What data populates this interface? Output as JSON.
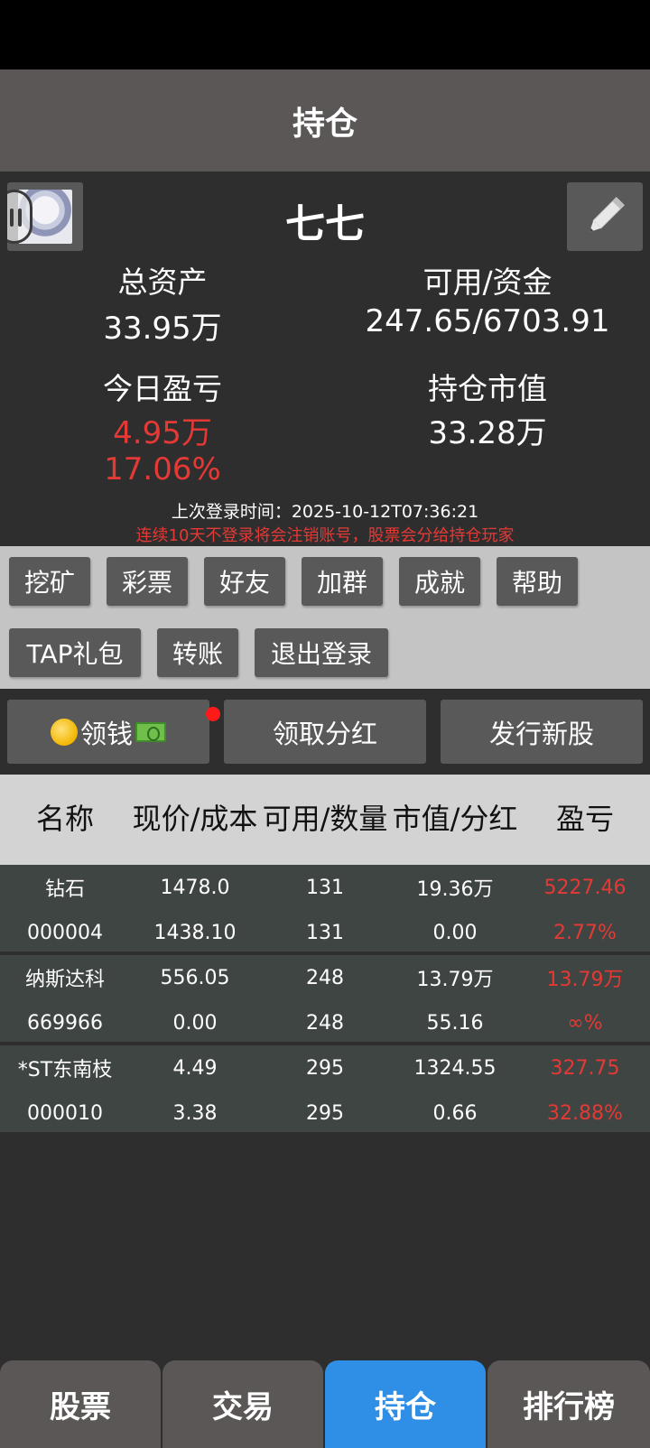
{
  "header": {
    "title": "持仓"
  },
  "profile": {
    "nickname": "七七",
    "total_assets_label": "总资产",
    "total_assets_value": "33.95万",
    "available_funds_label": "可用/资金",
    "available_funds_value": "247.65/6703.91",
    "today_pnl_label": "今日盈亏",
    "today_pnl_value": "4.95万",
    "today_pnl_percent": "17.06%",
    "market_value_label": "持仓市值",
    "market_value_value": "33.28万",
    "last_login": "上次登录时间：2025-10-12T07:36:21",
    "warning": "连续10天不登录将会注销账号，股票会分给持仓玩家"
  },
  "menu": {
    "mining": "挖矿",
    "lottery": "彩票",
    "friends": "好友",
    "join_group": "加群",
    "achievements": "成就",
    "help": "帮助",
    "tap_gift": "TAP礼包",
    "transfer": "转账",
    "logout": "退出登录"
  },
  "actions": {
    "collect_money": "领钱",
    "collect_dividend": "领取分红",
    "issue_stock": "发行新股"
  },
  "table": {
    "headers": [
      "名称",
      "现价/成本",
      "可用/数量",
      "市值/分红",
      "盈亏"
    ],
    "rows": [
      {
        "name": "钻石",
        "code": "000004",
        "price": "1478.0",
        "cost": "1438.10",
        "available": "131",
        "quantity": "131",
        "market_value": "19.36万",
        "dividend": "0.00",
        "pnl": "5227.46",
        "pnl_percent": "2.77%"
      },
      {
        "name": "纳斯达科",
        "code": "669966",
        "price": "556.05",
        "cost": "0.00",
        "available": "248",
        "quantity": "248",
        "market_value": "13.79万",
        "dividend": "55.16",
        "pnl": "13.79万",
        "pnl_percent": "∞%"
      },
      {
        "name": "*ST东南枝",
        "code": "000010",
        "price": "4.49",
        "cost": "3.38",
        "available": "295",
        "quantity": "295",
        "market_value": "1324.55",
        "dividend": "0.66",
        "pnl": "327.75",
        "pnl_percent": "32.88%"
      }
    ]
  },
  "bottom_nav": {
    "stocks": "股票",
    "trade": "交易",
    "holdings": "持仓",
    "ranking": "排行榜"
  },
  "colors": {
    "accent": "#2f8ee6",
    "loss_profit_red": "#e53935",
    "header_bg": "#5a5756",
    "panel_bg": "#2e2e2e",
    "menu_bg": "#c4c4c4",
    "row_bg": "#3f4542"
  },
  "icons": {
    "avatar": "anime-avatar-image",
    "edit": "pencil-icon",
    "coin": "coin-icon",
    "cash": "dollar-bill-icon"
  }
}
